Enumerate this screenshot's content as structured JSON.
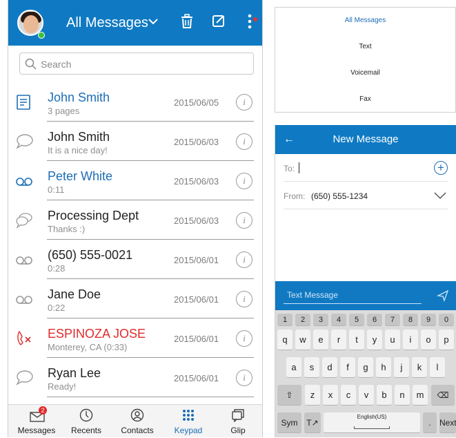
{
  "colors": {
    "brand": "#0f7ac3",
    "link": "#1c6db5",
    "alert": "#e02b2b"
  },
  "header": {
    "title": "All Messages"
  },
  "search": {
    "placeholder": "Search"
  },
  "messages": [
    {
      "name": "John Smith",
      "sub": "3 pages",
      "date": "2015/06/05",
      "icon": "fax-icon",
      "style": "blue"
    },
    {
      "name": "John Smith",
      "sub": "It is a nice day!",
      "date": "2015/06/03",
      "icon": "chat-bubble-icon",
      "style": "normal"
    },
    {
      "name": "Peter White",
      "sub": "0:11",
      "date": "2015/06/03",
      "icon": "voicemail-icon",
      "style": "blue"
    },
    {
      "name": "Processing Dept",
      "sub": "Thanks :)",
      "date": "2015/06/03",
      "icon": "group-chat-icon",
      "style": "normal"
    },
    {
      "name": "(650) 555-0021",
      "sub": "0:28",
      "date": "2015/06/01",
      "icon": "voicemail-icon",
      "style": "normal"
    },
    {
      "name": "Jane Doe",
      "sub": "0:22",
      "date": "2015/06/01",
      "icon": "voicemail-icon",
      "style": "normal"
    },
    {
      "name": "ESPINOZA JOSE",
      "sub": "Monterey, CA (0:33)",
      "date": "2015/06/01",
      "icon": "missed-call-icon",
      "style": "red"
    },
    {
      "name": "Ryan Lee",
      "sub": "Ready!",
      "date": "2015/06/01",
      "icon": "chat-bubble-icon",
      "style": "normal"
    }
  ],
  "nav": {
    "messages": "Messages",
    "messages_badge": "2",
    "recents": "Recents",
    "contacts": "Contacts",
    "keypad": "Keypad",
    "glip": "Glip"
  },
  "filter_menu": {
    "items": [
      "All Messages",
      "Text",
      "Voicemail",
      "Fax"
    ]
  },
  "new_message": {
    "title": "New Message",
    "to_label": "To:",
    "from_label": "From:",
    "from_value": "(650) 555-1234",
    "compose_placeholder": "Text Message"
  },
  "keyboard": {
    "numbers": [
      "1",
      "2",
      "3",
      "4",
      "5",
      "6",
      "7",
      "8",
      "9",
      "0"
    ],
    "row1": [
      "q",
      "w",
      "e",
      "r",
      "t",
      "y",
      "u",
      "i",
      "o",
      "p"
    ],
    "row2": [
      "a",
      "s",
      "d",
      "f",
      "g",
      "h",
      "j",
      "k",
      "l"
    ],
    "row3": [
      "z",
      "x",
      "c",
      "v",
      "b",
      "n",
      "m"
    ],
    "sym": "Sym",
    "space": "English(US)",
    "period": ".",
    "next": "Next"
  }
}
